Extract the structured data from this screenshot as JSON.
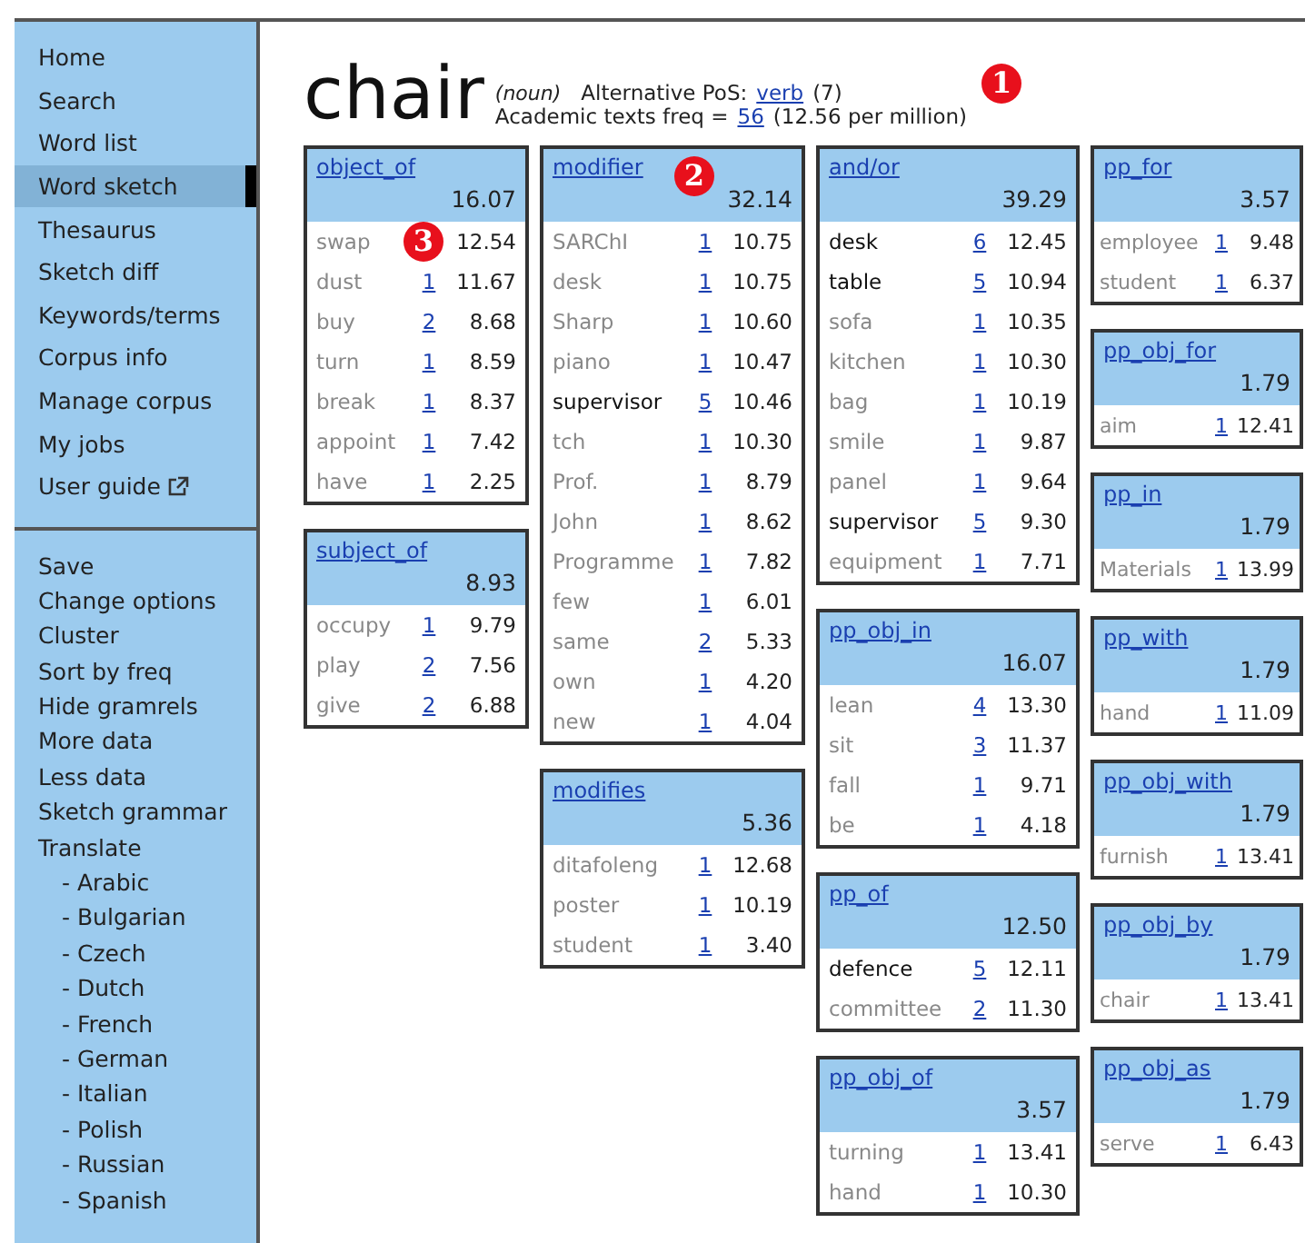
{
  "sidebar": {
    "nav": [
      {
        "label": "Home",
        "selected": false,
        "external": false
      },
      {
        "label": "Search",
        "selected": false,
        "external": false
      },
      {
        "label": "Word list",
        "selected": false,
        "external": false
      },
      {
        "label": "Word sketch",
        "selected": true,
        "external": false
      },
      {
        "label": "Thesaurus",
        "selected": false,
        "external": false
      },
      {
        "label": "Sketch diff",
        "selected": false,
        "external": false
      },
      {
        "label": "Keywords/terms",
        "selected": false,
        "external": false
      },
      {
        "label": "Corpus info",
        "selected": false,
        "external": false
      },
      {
        "label": "Manage corpus",
        "selected": false,
        "external": false
      },
      {
        "label": "My jobs",
        "selected": false,
        "external": false
      },
      {
        "label": "User guide",
        "selected": false,
        "external": true
      }
    ],
    "actions": [
      {
        "label": "Save"
      },
      {
        "label": "Change options"
      },
      {
        "label": "Cluster"
      },
      {
        "label": "Sort by freq"
      },
      {
        "label": "Hide gramrels"
      },
      {
        "label": "More data"
      },
      {
        "label": "Less data"
      },
      {
        "label": "Sketch grammar"
      },
      {
        "label": "Translate",
        "children": [
          {
            "label": "- Arabic"
          },
          {
            "label": "- Bulgarian"
          },
          {
            "label": "- Czech"
          },
          {
            "label": "- Dutch"
          },
          {
            "label": "- French"
          },
          {
            "label": "- German"
          },
          {
            "label": "- Italian"
          },
          {
            "label": "- Polish"
          },
          {
            "label": "- Russian"
          },
          {
            "label": "- Spanish"
          }
        ]
      }
    ]
  },
  "headword": {
    "word": "chair",
    "pos": "(noun)",
    "alt_pos_label": "Alternative PoS:",
    "alt_pos_link": "verb",
    "alt_pos_count": "(7)",
    "freq_label": "Academic texts freq =",
    "freq_link": "56",
    "freq_rate": "(12.56 per million)",
    "marker": "1"
  },
  "columns": [
    [
      {
        "relation": "object_of",
        "score": "16.07",
        "rows": [
          {
            "word": "swap",
            "score": "12.54",
            "emphasized": false,
            "marker": "3"
          },
          {
            "word": "dust",
            "count": "1",
            "score": "11.67",
            "emphasized": false
          },
          {
            "word": "buy",
            "count": "2",
            "score": "8.68",
            "emphasized": false
          },
          {
            "word": "turn",
            "count": "1",
            "score": "8.59",
            "emphasized": false
          },
          {
            "word": "break",
            "count": "1",
            "score": "8.37",
            "emphasized": false
          },
          {
            "word": "appoint",
            "count": "1",
            "score": "7.42",
            "emphasized": false
          },
          {
            "word": "have",
            "count": "1",
            "score": "2.25",
            "emphasized": false
          }
        ]
      },
      {
        "relation": "subject_of",
        "score": "8.93",
        "rows": [
          {
            "word": "occupy",
            "count": "1",
            "score": "9.79",
            "emphasized": false
          },
          {
            "word": "play",
            "count": "2",
            "score": "7.56",
            "emphasized": false
          },
          {
            "word": "give",
            "count": "2",
            "score": "6.88",
            "emphasized": false
          }
        ]
      }
    ],
    [
      {
        "relation": "modifier",
        "score": "32.14",
        "marker": "2",
        "rows": [
          {
            "word": "SARChI",
            "count": "1",
            "score": "10.75",
            "emphasized": false
          },
          {
            "word": "desk",
            "count": "1",
            "score": "10.75",
            "emphasized": false
          },
          {
            "word": "Sharp",
            "count": "1",
            "score": "10.60",
            "emphasized": false
          },
          {
            "word": "piano",
            "count": "1",
            "score": "10.47",
            "emphasized": false
          },
          {
            "word": "supervisor",
            "count": "5",
            "score": "10.46",
            "emphasized": true
          },
          {
            "word": "tch",
            "count": "1",
            "score": "10.30",
            "emphasized": false
          },
          {
            "word": "Prof.",
            "count": "1",
            "score": "8.79",
            "emphasized": false
          },
          {
            "word": "John",
            "count": "1",
            "score": "8.62",
            "emphasized": false
          },
          {
            "word": "Programme",
            "count": "1",
            "score": "7.82",
            "emphasized": false
          },
          {
            "word": "few",
            "count": "1",
            "score": "6.01",
            "emphasized": false
          },
          {
            "word": "same",
            "count": "2",
            "score": "5.33",
            "emphasized": false
          },
          {
            "word": "own",
            "count": "1",
            "score": "4.20",
            "emphasized": false
          },
          {
            "word": "new",
            "count": "1",
            "score": "4.04",
            "emphasized": false
          }
        ]
      },
      {
        "relation": "modifies",
        "score": "5.36",
        "rows": [
          {
            "word": "ditafoleng",
            "count": "1",
            "score": "12.68",
            "emphasized": false
          },
          {
            "word": "poster",
            "count": "1",
            "score": "10.19",
            "emphasized": false
          },
          {
            "word": "student",
            "count": "1",
            "score": "3.40",
            "emphasized": false
          }
        ]
      }
    ],
    [
      {
        "relation": "and/or",
        "score": "39.29",
        "rows": [
          {
            "word": "desk",
            "count": "6",
            "score": "12.45",
            "emphasized": true
          },
          {
            "word": "table",
            "count": "5",
            "score": "10.94",
            "emphasized": true
          },
          {
            "word": "sofa",
            "count": "1",
            "score": "10.35",
            "emphasized": false
          },
          {
            "word": "kitchen",
            "count": "1",
            "score": "10.30",
            "emphasized": false
          },
          {
            "word": "bag",
            "count": "1",
            "score": "10.19",
            "emphasized": false
          },
          {
            "word": "smile",
            "count": "1",
            "score": "9.87",
            "emphasized": false
          },
          {
            "word": "panel",
            "count": "1",
            "score": "9.64",
            "emphasized": false
          },
          {
            "word": "supervisor",
            "count": "5",
            "score": "9.30",
            "emphasized": true
          },
          {
            "word": "equipment",
            "count": "1",
            "score": "7.71",
            "emphasized": false
          }
        ]
      },
      {
        "relation": "pp_obj_in",
        "score": "16.07",
        "rows": [
          {
            "word": "lean",
            "count": "4",
            "score": "13.30",
            "emphasized": false
          },
          {
            "word": "sit",
            "count": "3",
            "score": "11.37",
            "emphasized": false
          },
          {
            "word": "fall",
            "count": "1",
            "score": "9.71",
            "emphasized": false
          },
          {
            "word": "be",
            "count": "1",
            "score": "4.18",
            "emphasized": false
          }
        ]
      },
      {
        "relation": "pp_of",
        "score": "12.50",
        "rows": [
          {
            "word": "defence",
            "count": "5",
            "score": "12.11",
            "emphasized": true
          },
          {
            "word": "committee",
            "count": "2",
            "score": "11.30",
            "emphasized": false
          }
        ]
      },
      {
        "relation": "pp_obj_of",
        "score": "3.57",
        "rows": [
          {
            "word": "turning",
            "count": "1",
            "score": "13.41",
            "emphasized": false
          },
          {
            "word": "hand",
            "count": "1",
            "score": "10.30",
            "emphasized": false
          }
        ]
      }
    ],
    [
      {
        "relation": "pp_for",
        "score": "3.57",
        "rows": [
          {
            "word": "employee",
            "count": "1",
            "score": "9.48",
            "emphasized": false
          },
          {
            "word": "student",
            "count": "1",
            "score": "6.37",
            "emphasized": false
          }
        ]
      },
      {
        "relation": "pp_obj_for",
        "score": "1.79",
        "rows": [
          {
            "word": "aim",
            "count": "1",
            "score": "12.41",
            "emphasized": false
          }
        ]
      },
      {
        "relation": "pp_in",
        "score": "1.79",
        "rows": [
          {
            "word": "Materials",
            "count": "1",
            "score": "13.99",
            "emphasized": false
          }
        ]
      },
      {
        "relation": "pp_with",
        "score": "1.79",
        "rows": [
          {
            "word": "hand",
            "count": "1",
            "score": "11.09",
            "emphasized": false
          }
        ]
      },
      {
        "relation": "pp_obj_with",
        "score": "1.79",
        "rows": [
          {
            "word": "furnish",
            "count": "1",
            "score": "13.41",
            "emphasized": false
          }
        ]
      },
      {
        "relation": "pp_obj_by",
        "score": "1.79",
        "rows": [
          {
            "word": "chair",
            "count": "1",
            "score": "13.41",
            "emphasized": false
          }
        ]
      },
      {
        "relation": "pp_obj_as",
        "score": "1.79",
        "rows": [
          {
            "word": "serve",
            "count": "1",
            "score": "6.43",
            "emphasized": false
          }
        ]
      }
    ]
  ]
}
